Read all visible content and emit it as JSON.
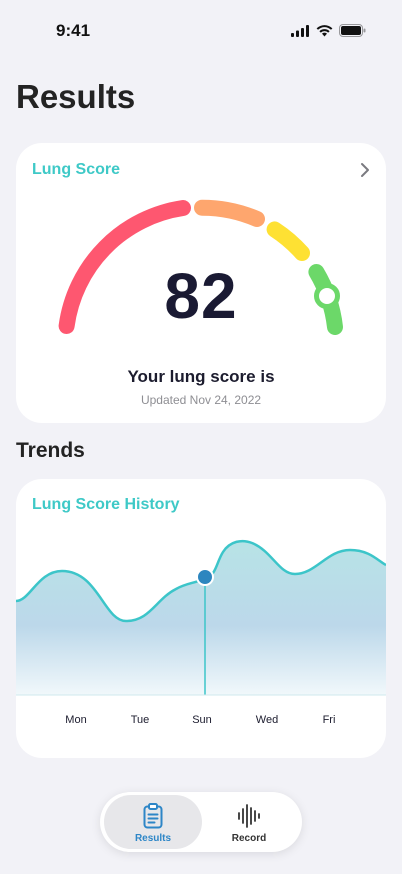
{
  "status_bar": {
    "time": "9:41",
    "icons": [
      "signal-icon",
      "wifi-icon",
      "battery-icon"
    ]
  },
  "page": {
    "title": "Results"
  },
  "lung_score_card": {
    "title": "Lung Score",
    "score": "82",
    "caption": "Your lung score is",
    "updated": "Updated Nov 24, 2022",
    "score_fraction": 0.82,
    "gauge_segments": [
      {
        "name": "red",
        "color": "#fe5770"
      },
      {
        "name": "orange",
        "color": "#fea66e"
      },
      {
        "name": "yellow",
        "color": "#fee133"
      },
      {
        "name": "green",
        "color": "#6cd869"
      }
    ]
  },
  "trends": {
    "section_title": "Trends",
    "card_title": "Lung Score History",
    "days": [
      "Mon",
      "Tue",
      "Sun",
      "Wed",
      "Fri"
    ],
    "selected_day": "Sun",
    "colors": {
      "line": "#3cc5c9",
      "marker": "#2d86bf"
    }
  },
  "tabbar": {
    "tabs": [
      {
        "label": "Results",
        "icon": "clipboard-icon",
        "active": true,
        "color": "#2d86c7"
      },
      {
        "label": "Record",
        "icon": "waveform-icon",
        "active": false,
        "color": "#333333"
      }
    ]
  }
}
